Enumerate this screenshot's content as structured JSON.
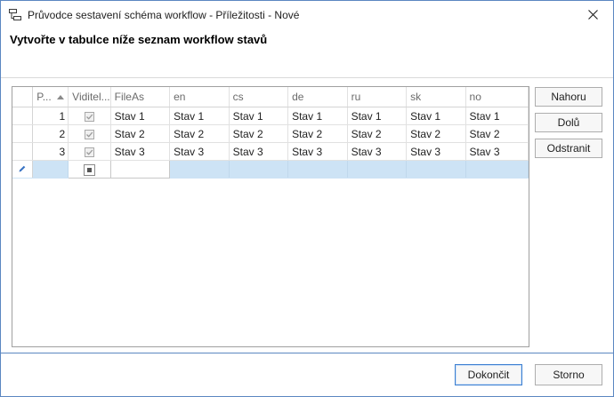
{
  "window": {
    "title": "Průvodce sestavení schéma workflow - Příležitosti - Nové"
  },
  "heading": "Vytvořte v tabulce níže seznam workflow stavů",
  "grid": {
    "columns": [
      "P...",
      "Viditel...",
      "FileAs",
      "en",
      "cs",
      "de",
      "ru",
      "sk",
      "no"
    ],
    "rows": [
      {
        "pos": "1",
        "visible": true,
        "values": [
          "Stav 1",
          "Stav 1",
          "Stav 1",
          "Stav 1",
          "Stav 1",
          "Stav 1",
          "Stav 1"
        ]
      },
      {
        "pos": "2",
        "visible": true,
        "values": [
          "Stav 2",
          "Stav 2",
          "Stav 2",
          "Stav 2",
          "Stav 2",
          "Stav 2",
          "Stav 2"
        ]
      },
      {
        "pos": "3",
        "visible": true,
        "values": [
          "Stav 3",
          "Stav 3",
          "Stav 3",
          "Stav 3",
          "Stav 3",
          "Stav 3",
          "Stav 3"
        ]
      }
    ]
  },
  "side_buttons": {
    "up": "Nahoru",
    "down": "Dolů",
    "remove": "Odstranit"
  },
  "footer": {
    "finish": "Dokončit",
    "cancel": "Storno"
  },
  "icons": {
    "app": "wizard-app-icon",
    "close": "close-icon",
    "edit": "pencil-icon",
    "sort": "sort-ascending-icon",
    "checkbox": "check-icon"
  },
  "colors": {
    "accent_border": "#5b87c1",
    "new_row_fill": "#cde3f5",
    "primary_button_border": "#3c7fd1"
  }
}
